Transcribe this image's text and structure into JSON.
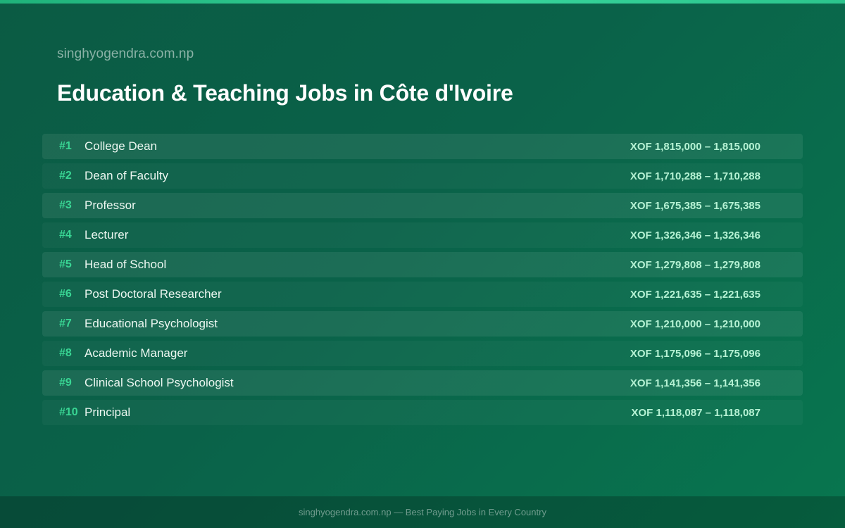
{
  "brand": "singhyogendra.com.np",
  "title": "Education & Teaching Jobs in Côte d'Ivoire",
  "jobs": [
    {
      "rank": "#1",
      "title": "College Dean",
      "salary": "XOF 1,815,000 – 1,815,000"
    },
    {
      "rank": "#2",
      "title": "Dean of Faculty",
      "salary": "XOF 1,710,288 – 1,710,288"
    },
    {
      "rank": "#3",
      "title": "Professor",
      "salary": "XOF 1,675,385 – 1,675,385"
    },
    {
      "rank": "#4",
      "title": "Lecturer",
      "salary": "XOF 1,326,346 – 1,326,346"
    },
    {
      "rank": "#5",
      "title": "Head of School",
      "salary": "XOF 1,279,808 – 1,279,808"
    },
    {
      "rank": "#6",
      "title": "Post Doctoral Researcher",
      "salary": "XOF 1,221,635 – 1,221,635"
    },
    {
      "rank": "#7",
      "title": "Educational Psychologist",
      "salary": "XOF 1,210,000 – 1,210,000"
    },
    {
      "rank": "#8",
      "title": "Academic Manager",
      "salary": "XOF 1,175,096 – 1,175,096"
    },
    {
      "rank": "#9",
      "title": "Clinical School Psychologist",
      "salary": "XOF 1,141,356 – 1,141,356"
    },
    {
      "rank": "#10",
      "title": "Principal",
      "salary": "XOF 1,118,087 – 1,118,087"
    }
  ],
  "footer": "singhyogendra.com.np — Best Paying Jobs in Every Country",
  "colors": {
    "background_start": "#0b5b44",
    "background_end": "#08764f",
    "accent": "#39d694",
    "salary": "#b6f2d4",
    "top_bar": "#2cc58d"
  }
}
